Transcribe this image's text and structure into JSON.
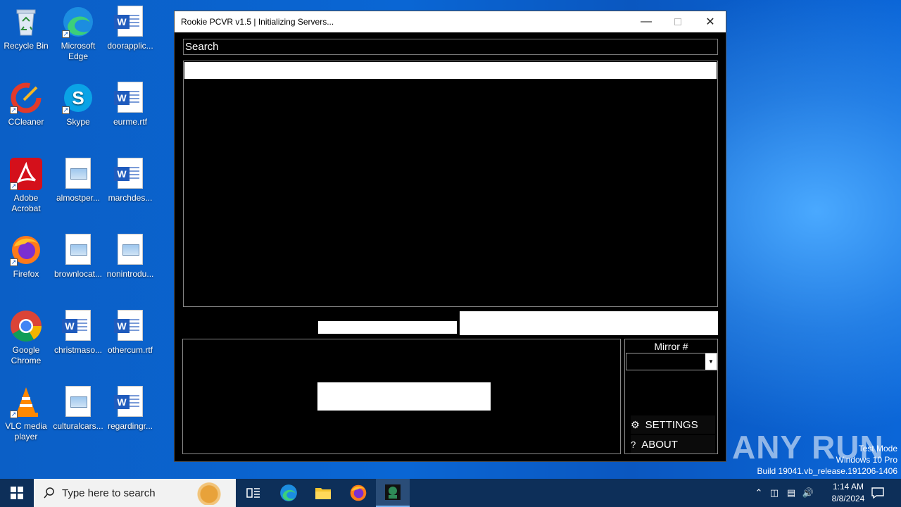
{
  "desktop": {
    "icons": [
      {
        "label": "Recycle Bin"
      },
      {
        "label": "Microsoft Edge"
      },
      {
        "label": "doorapplic..."
      },
      {
        "label": "CCleaner"
      },
      {
        "label": "Skype"
      },
      {
        "label": "eurme.rtf"
      },
      {
        "label": "Adobe Acrobat"
      },
      {
        "label": "almostper..."
      },
      {
        "label": "marchdes..."
      },
      {
        "label": "Firefox"
      },
      {
        "label": "brownlocat..."
      },
      {
        "label": "nonintrodu..."
      },
      {
        "label": "Google Chrome"
      },
      {
        "label": "christmaso..."
      },
      {
        "label": "othercum.rtf"
      },
      {
        "label": "VLC media player"
      },
      {
        "label": "culturalcars..."
      },
      {
        "label": "regardingr..."
      }
    ]
  },
  "window": {
    "title": "Rookie PCVR v1.5 | Initializing Servers...",
    "search_placeholder": "Search",
    "mirror_label": "Mirror #",
    "settings_label": "SETTINGS",
    "about_label": "ABOUT",
    "about_glyph": "?"
  },
  "watermark": {
    "text": "ANY RUN",
    "test_mode": "Test Mode",
    "os": "Windows 10 Pro",
    "build": "Build 19041.vb_release.191206-1406"
  },
  "taskbar": {
    "search_placeholder": "Type here to search",
    "time": "1:14 AM",
    "date": "8/8/2024"
  }
}
